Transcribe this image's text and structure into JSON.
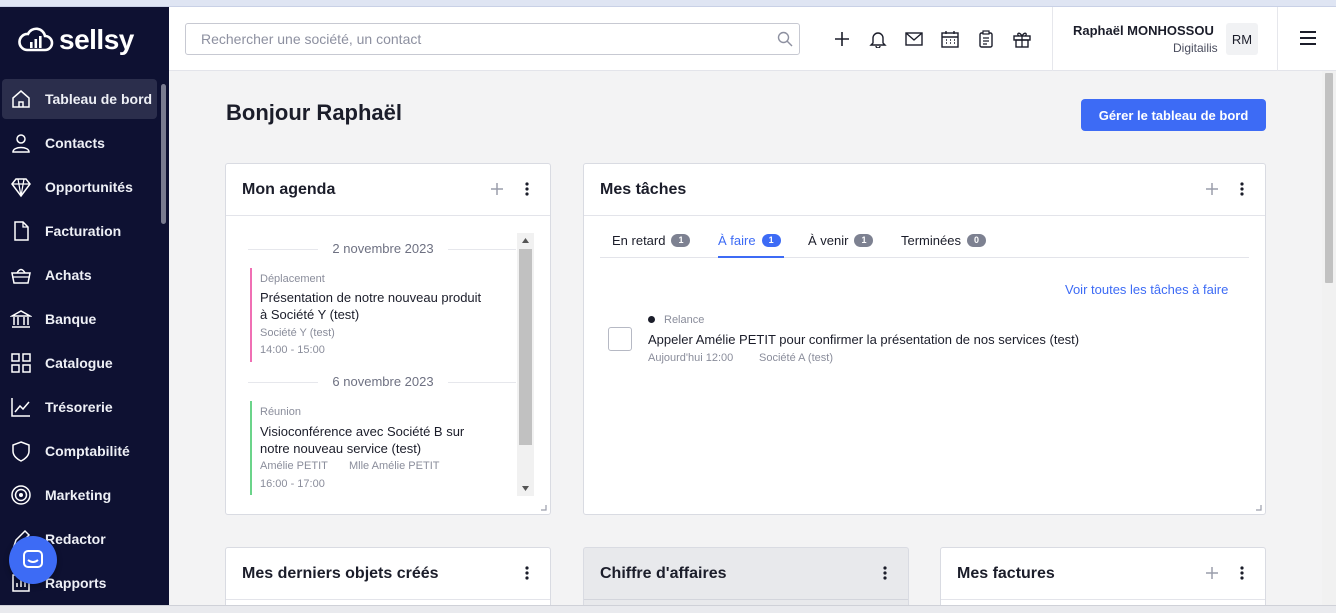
{
  "brand": {
    "name": "sellsy"
  },
  "sidebar": {
    "items": [
      {
        "label": "Tableau de bord",
        "icon": "home-icon"
      },
      {
        "label": "Contacts",
        "icon": "person-icon"
      },
      {
        "label": "Opportunités",
        "icon": "diamond-icon"
      },
      {
        "label": "Facturation",
        "icon": "document-icon"
      },
      {
        "label": "Achats",
        "icon": "basket-icon"
      },
      {
        "label": "Banque",
        "icon": "bank-icon"
      },
      {
        "label": "Catalogue",
        "icon": "grid-icon"
      },
      {
        "label": "Trésorerie",
        "icon": "trend-chart-icon"
      },
      {
        "label": "Comptabilité",
        "icon": "shield-icon"
      },
      {
        "label": "Marketing",
        "icon": "target-icon"
      },
      {
        "label": "Redactor",
        "icon": "pen-icon"
      },
      {
        "label": "Rapports",
        "icon": "report-icon"
      }
    ],
    "active_index": 0
  },
  "header": {
    "search_placeholder": "Rechercher une société, un contact",
    "icons": [
      "plus-icon",
      "bell-icon",
      "mail-icon",
      "calendar-icon",
      "clipboard-icon",
      "gift-icon"
    ],
    "user_name": "Raphaël MONHOSSOU",
    "user_org": "Digitailis",
    "avatar_initials": "RM"
  },
  "main": {
    "greeting": "Bonjour Raphaël",
    "manage_button": "Gérer le tableau de bord"
  },
  "agenda": {
    "title": "Mon agenda",
    "days": [
      {
        "date": "2 novembre 2023",
        "event": {
          "type": "Déplacement",
          "title_line1": "Présentation de notre nouveau produit",
          "title_line2": "à Société Y (test)",
          "company": "Société Y (test)",
          "time": "14:00 - 15:00",
          "color": "#f06fb4"
        }
      },
      {
        "date": "6 novembre 2023",
        "event": {
          "type": "Réunion",
          "title_line1": "Visioconférence avec Société B sur",
          "title_line2": "notre nouveau service (test)",
          "attendee1": "Amélie PETIT",
          "attendee2": "Mlle Amélie PETIT",
          "time": "16:00 - 17:00",
          "color": "#6bd48a"
        }
      }
    ]
  },
  "tasks": {
    "title": "Mes tâches",
    "tabs": [
      {
        "label": "En retard",
        "count": "1"
      },
      {
        "label": "À faire",
        "count": "1"
      },
      {
        "label": "À venir",
        "count": "1"
      },
      {
        "label": "Terminées",
        "count": "0"
      }
    ],
    "active_tab": 1,
    "see_all": "Voir toutes les tâches à faire",
    "items": [
      {
        "type": "Relance",
        "title": "Appeler Amélie PETIT pour confirmer la présentation de nos services (test)",
        "date": "Aujourd'hui 12:00",
        "company": "Société A (test)"
      }
    ]
  },
  "bottom_cards": [
    {
      "title": "Mes derniers objets créés"
    },
    {
      "title": "Chiffre d'affaires"
    },
    {
      "title": "Mes factures"
    }
  ],
  "colors": {
    "accent": "#3d6bf5",
    "sidebar_bg": "#0e1132"
  }
}
